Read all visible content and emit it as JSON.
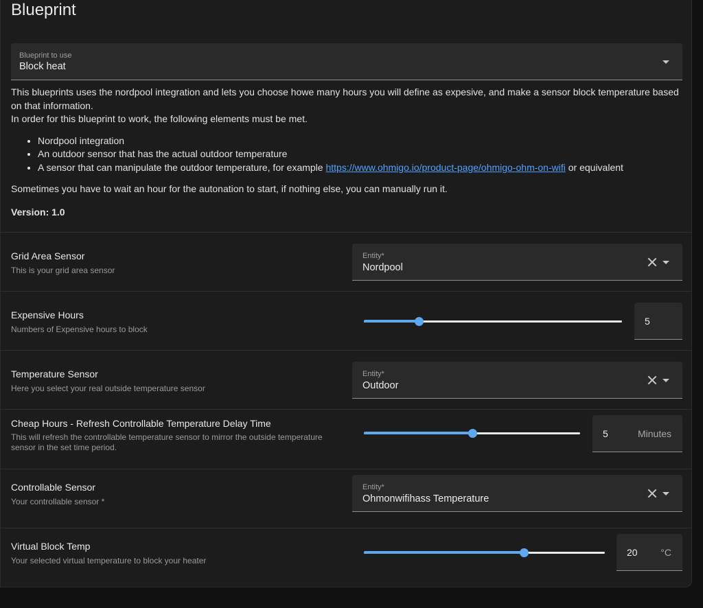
{
  "page": {
    "title": "Blueprint"
  },
  "blueprint_select": {
    "label": "Blueprint to use",
    "value": "Block heat"
  },
  "description": {
    "para1": "This blueprints uses the nordpool integration and lets you choose howe many hours you will define as expesive, and make a sensor block temperature based on that information.",
    "para2": "In order for this blueprint to work, the following elements must be met.",
    "bullets": [
      "Nordpool integration",
      "An outdoor sensor that has the actual outdoor temperature"
    ],
    "bullet3_prefix": "A sensor that can manipulate the outdoor temperature, for example ",
    "bullet3_link": "https://www.ohmigo.io/product-page/ohmigo-ohm-on-wifi",
    "bullet3_suffix": " or equivalent",
    "para3": "Sometimes you have to wait an hour for the autonation to start, if nothing else, you can manually run it.",
    "version": "Version: 1.0"
  },
  "inputs": {
    "grid_area": {
      "name": "Grid Area Sensor",
      "help": "This is your grid area sensor",
      "field_label": "Entity*",
      "value": "Nordpool"
    },
    "expensive_hours": {
      "name": "Expensive Hours",
      "help": "Numbers of Expensive hours to block",
      "value": "5",
      "unit": "",
      "slider_fraction": 0.214
    },
    "temperature_sensor": {
      "name": "Temperature Sensor",
      "help": "Here you select your real outside temperature sensor",
      "field_label": "Entity*",
      "value": "Outdoor"
    },
    "cheap_hours": {
      "name": "Cheap Hours - Refresh Controllable Temperature Delay Time",
      "help": "This will refresh the controllable temperature sensor to mirror the outside temperature sensor in the set time period.",
      "value": "5",
      "unit": "Minutes",
      "slider_fraction": 0.5
    },
    "controllable_sensor": {
      "name": "Controllable Sensor",
      "help": "Your controllable sensor *",
      "field_label": "Entity*",
      "value": "Ohmonwifihass Temperature"
    },
    "virtual_block_temp": {
      "name": "Virtual Block Temp",
      "help": "Your selected virtual temperature to block your heater",
      "value": "20",
      "unit": "°C",
      "slider_fraction": 0.664
    }
  },
  "icons": {
    "dropdown": "chevron-down-icon",
    "clear": "close-icon"
  },
  "colors": {
    "accent": "#5ea8f0",
    "link": "#4fa3ff",
    "card": "#1c1c1c",
    "field": "#2a2a2a"
  }
}
